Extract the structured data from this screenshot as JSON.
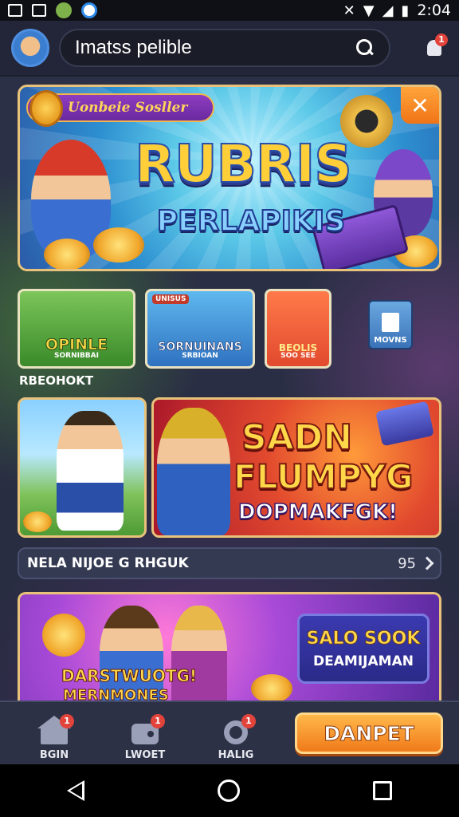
{
  "status_bar": {
    "time": "2:04",
    "left_icons": [
      "gallery-icon",
      "gallery-icon",
      "app-icon",
      "app-icon"
    ],
    "right_icons": [
      "mute-icon",
      "wifi-icon",
      "signal-icon",
      "battery-icon"
    ]
  },
  "header": {
    "search_text": "Imatss pelible",
    "notification_count": "1"
  },
  "hero": {
    "tag": "Uonbeie Sosller",
    "title": "RUBRIS",
    "subtitle": "PERLAPIKIS",
    "close_label": "✕"
  },
  "tiles": [
    {
      "label": "OPINLE",
      "sub": "SORNIBBAI"
    },
    {
      "label": "SORNUINANS",
      "sub": "SRBIOAN",
      "top": "UNISUS"
    },
    {
      "label": "BEOLIS",
      "sub": "SOO SEE"
    },
    {
      "label": "MOVNS"
    }
  ],
  "section_label": "RBEOHOKT",
  "promo": {
    "line1": "SADN",
    "line2": "FLUMPYG",
    "line3": "DOPMAKFGK!"
  },
  "list_row": {
    "label": "NELA NIJOE G RHGUK",
    "count": "95"
  },
  "banner": {
    "line1": "DARSTWUOTG!",
    "line2": "MERNMONES",
    "box_title": "SALO SOOK",
    "box_sub": "DEAMIJAMAN"
  },
  "bottom_nav": {
    "items": [
      {
        "label": "BGIN",
        "icon": "home-icon",
        "badge": "1"
      },
      {
        "label": "LWOET",
        "icon": "wallet-icon",
        "badge": "1"
      },
      {
        "label": "HALIG",
        "icon": "ring-icon",
        "badge": "1"
      }
    ],
    "deposit_label": "DANPET"
  },
  "colors": {
    "accent_orange": "#f07a1a",
    "badge_red": "#e2433b",
    "frame_gold": "#e8c27a"
  }
}
